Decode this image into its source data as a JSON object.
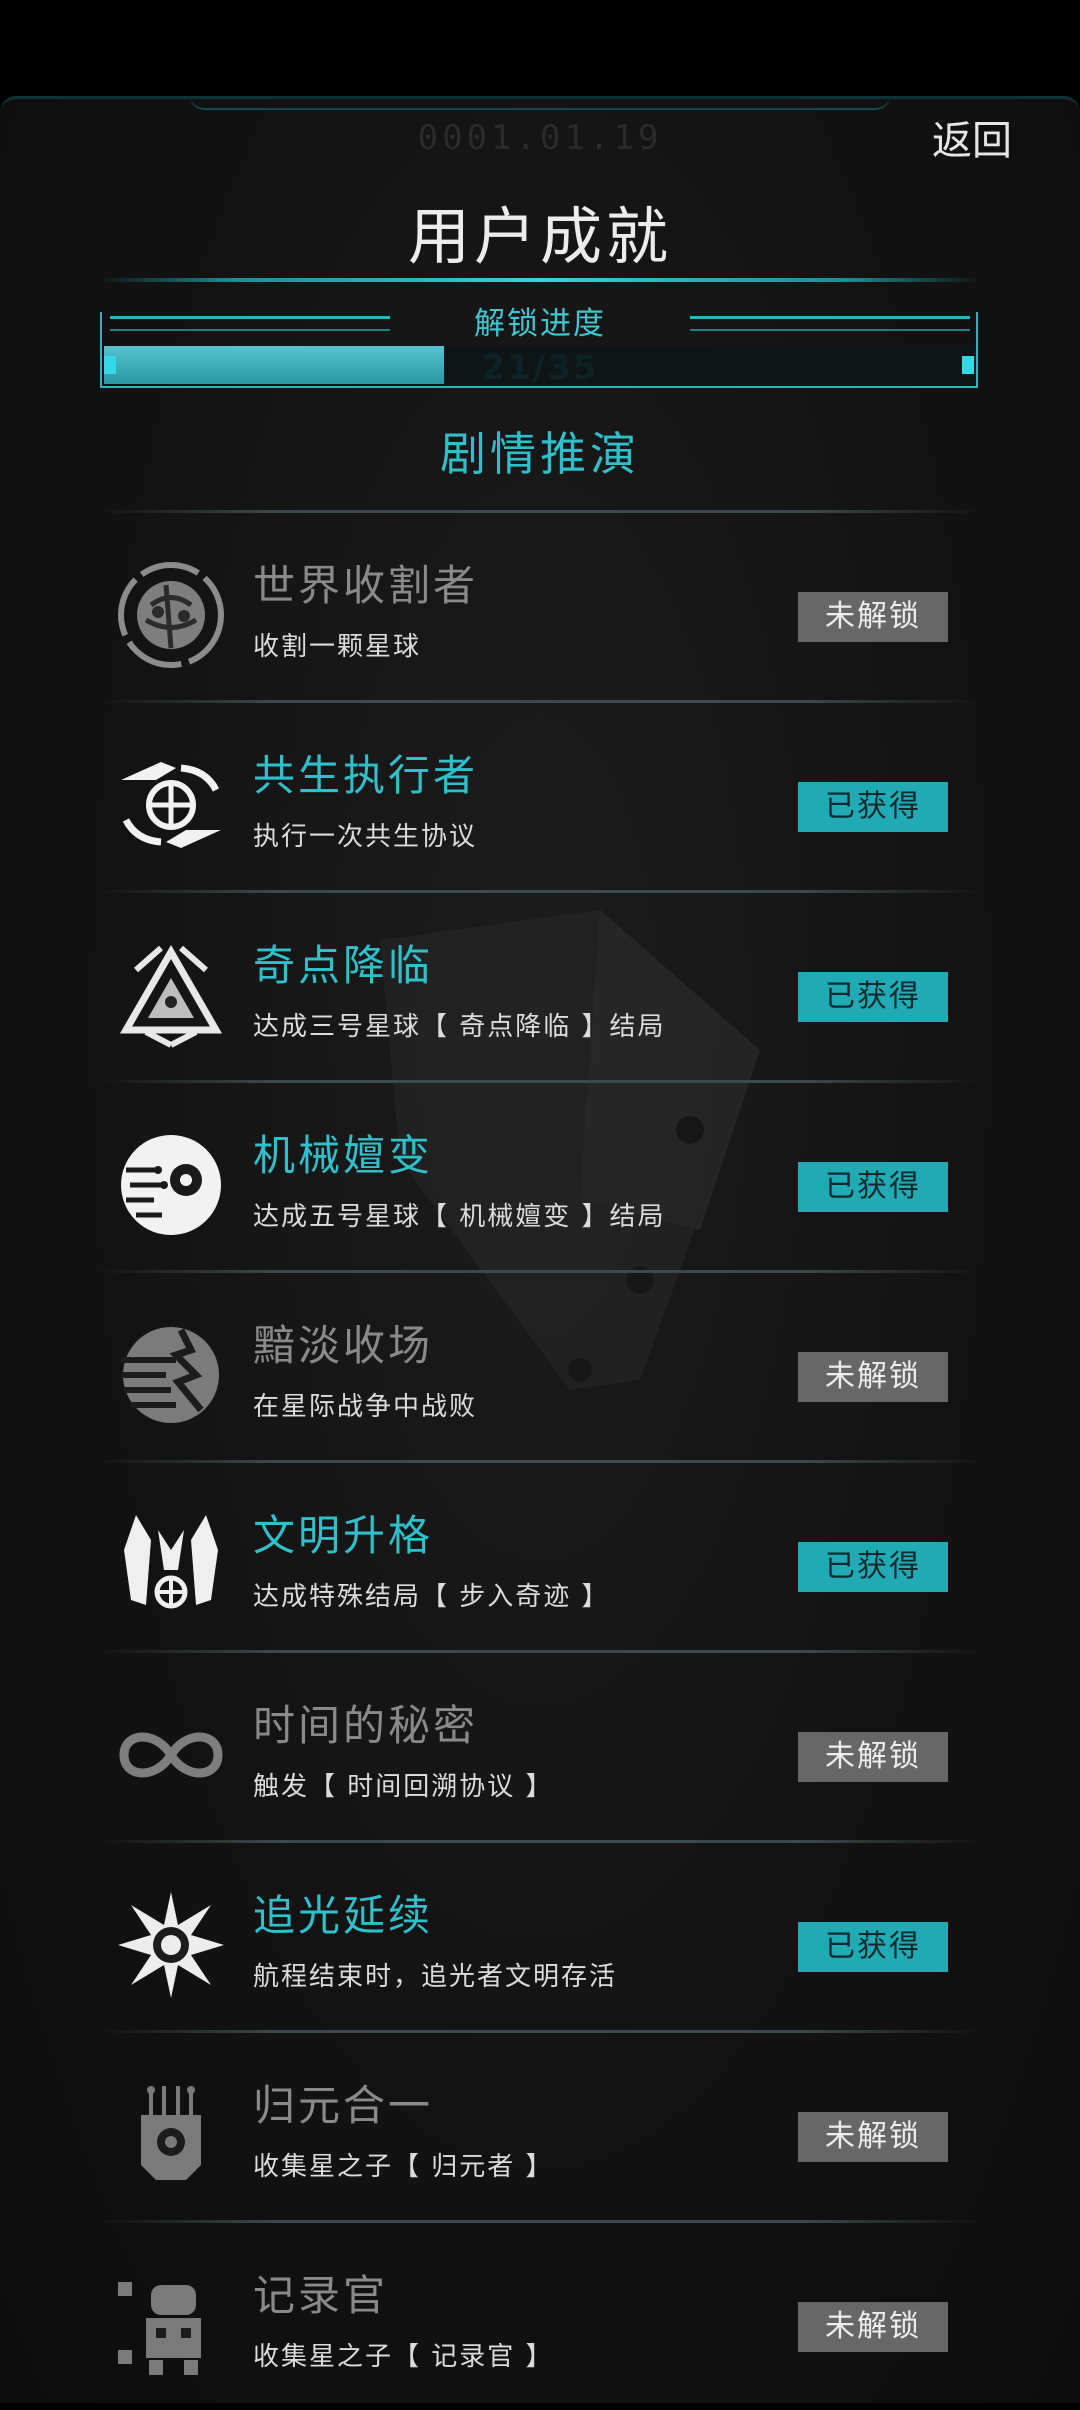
{
  "header": {
    "date": "0001.01.19",
    "back_label": "返回",
    "title": "用户成就"
  },
  "progress": {
    "label": "解锁进度",
    "text": "21/35",
    "unlocked": 21,
    "total": 35,
    "fill_fraction": 0.39
  },
  "section_title": "剧情推演",
  "colors": {
    "accent": "#2fc0cb",
    "badge_got": "#20aab4",
    "badge_locked": "#676767",
    "name_locked": "#8a8a8a"
  },
  "achievements": [
    {
      "name": "世界收割者",
      "desc": "收割一颗星球",
      "status": "未解锁",
      "unlocked": false,
      "icon": "planet-harvest-icon"
    },
    {
      "name": "共生执行者",
      "desc": "执行一次共生协议",
      "status": "已获得",
      "unlocked": true,
      "icon": "symbiosis-globe-icon"
    },
    {
      "name": "奇点降临",
      "desc": "达成三号星球【 奇点降临 】结局",
      "status": "已获得",
      "unlocked": true,
      "icon": "singularity-triangle-icon"
    },
    {
      "name": "机械嬗变",
      "desc": "达成五号星球【 机械嬗变 】结局",
      "status": "已获得",
      "unlocked": true,
      "icon": "cyber-eye-icon"
    },
    {
      "name": "黯淡收场",
      "desc": "在星际战争中战败",
      "status": "未解锁",
      "unlocked": false,
      "icon": "shattered-planet-icon"
    },
    {
      "name": "文明升格",
      "desc": "达成特殊结局【 步入奇迹 】",
      "status": "已获得",
      "unlocked": true,
      "icon": "winged-emblem-icon"
    },
    {
      "name": "时间的秘密",
      "desc": "触发【 时间回溯协议 】",
      "status": "未解锁",
      "unlocked": false,
      "icon": "infinity-icon"
    },
    {
      "name": "追光延续",
      "desc": "航程结束时，追光者文明存活",
      "status": "已获得",
      "unlocked": true,
      "icon": "radiant-sun-icon"
    },
    {
      "name": "归元合一",
      "desc": "收集星之子【 归元者 】",
      "status": "未解锁",
      "unlocked": false,
      "icon": "circuit-mask-icon"
    },
    {
      "name": "记录官",
      "desc": "收集星之子【 记录官 】",
      "status": "未解锁",
      "unlocked": false,
      "icon": "recorder-robot-icon"
    }
  ]
}
